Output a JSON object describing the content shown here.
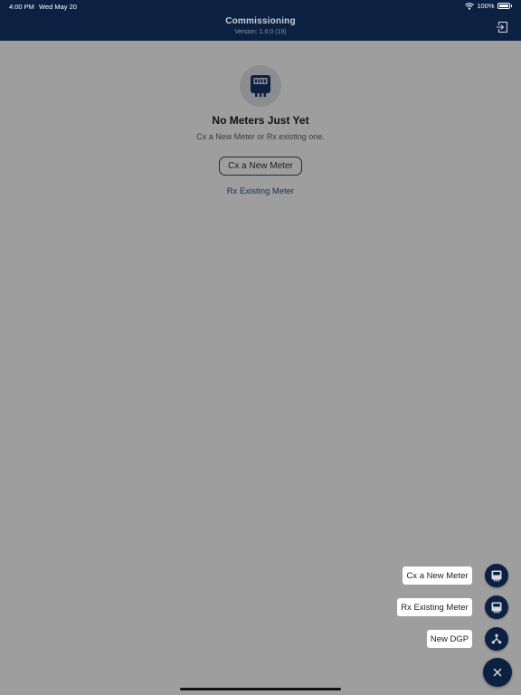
{
  "status_bar": {
    "time": "4:00 PM",
    "date": "Wed May 20",
    "battery": "100%"
  },
  "header": {
    "title": "Commissioning",
    "subtitle": "Version: 1.0.0 (19)"
  },
  "empty_state": {
    "title": "No Meters Just Yet",
    "subtitle": "Cx a New Meter or Rx existing one.",
    "cx_button": "Cx a New Meter",
    "rx_link": "Rx Existing Meter"
  },
  "speed_dial": {
    "actions": [
      {
        "label": "Cx a New Meter",
        "icon": "meter-icon"
      },
      {
        "label": "Rx Existing Meter",
        "icon": "meter-icon"
      },
      {
        "label": "New DGP",
        "icon": "network-icon"
      }
    ],
    "close_icon": "close-icon"
  },
  "colors": {
    "navy": "#0c2141",
    "overlay_gray": "#9e9e9e"
  }
}
